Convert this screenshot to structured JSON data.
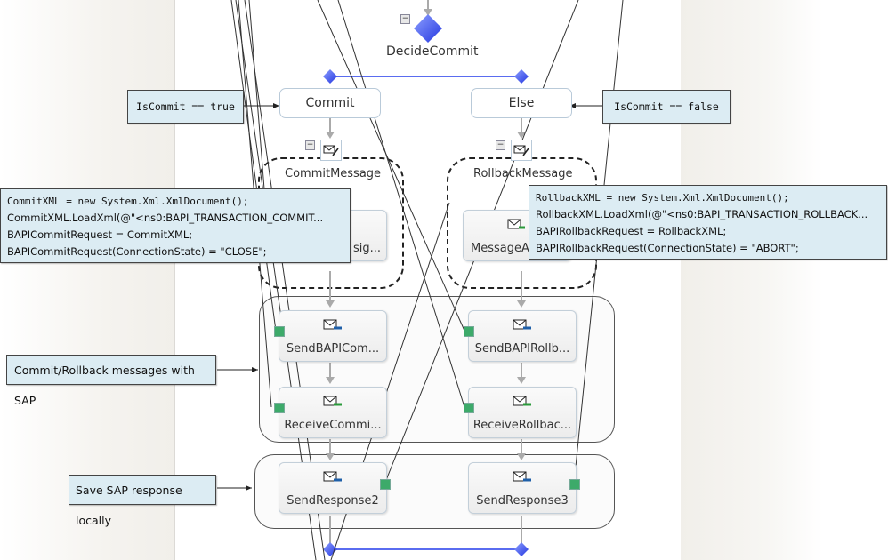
{
  "decide": {
    "label": "DecideCommit"
  },
  "branches": [
    {
      "label": "Commit"
    },
    {
      "label": "Else"
    }
  ],
  "scopes": [
    {
      "label": "CommitMessage",
      "inner_shape": "...sig...",
      "inner_visible": "sig..."
    },
    {
      "label": "RollbackMessage",
      "inner_visible": "MessageA"
    }
  ],
  "shapes": {
    "send_commit": "SendBAPICom...",
    "receive_commit": "ReceiveCommi...",
    "send_rollback": "SendBAPIRollb...",
    "receive_rollback": "ReceiveRollbac...",
    "send_response2": "SendResponse2",
    "send_response3": "SendResponse3"
  },
  "callouts": {
    "commit_true": "IsCommit == true",
    "commit_false": "IsCommit == false",
    "commit_code": [
      "CommitXML = new System.Xml.XmlDocument();",
      "CommitXML.LoadXml(@\"<ns0:BAPI_TRANSACTION_COMMIT...",
      "BAPICommitRequest = CommitXML;",
      "BAPICommitRequest(ConnectionState) = \"CLOSE\";"
    ],
    "rollback_code": [
      "RollbackXML = new System.Xml.XmlDocument();",
      "RollbackXML.LoadXml(@\"<ns0:BAPI_TRANSACTION_ROLLBACK...",
      "BAPIRollbackRequest = RollbackXML;",
      "BAPIRollbackRequest(ConnectionState) = \"ABORT\";"
    ],
    "sap_messages": "Commit/Rollback messages with SAP",
    "save_response": "Save SAP response locally"
  },
  "colors": {
    "decision_blue": "#4a63f0",
    "port_green": "#3daa6a",
    "callout_bg": "#dcecf3"
  }
}
